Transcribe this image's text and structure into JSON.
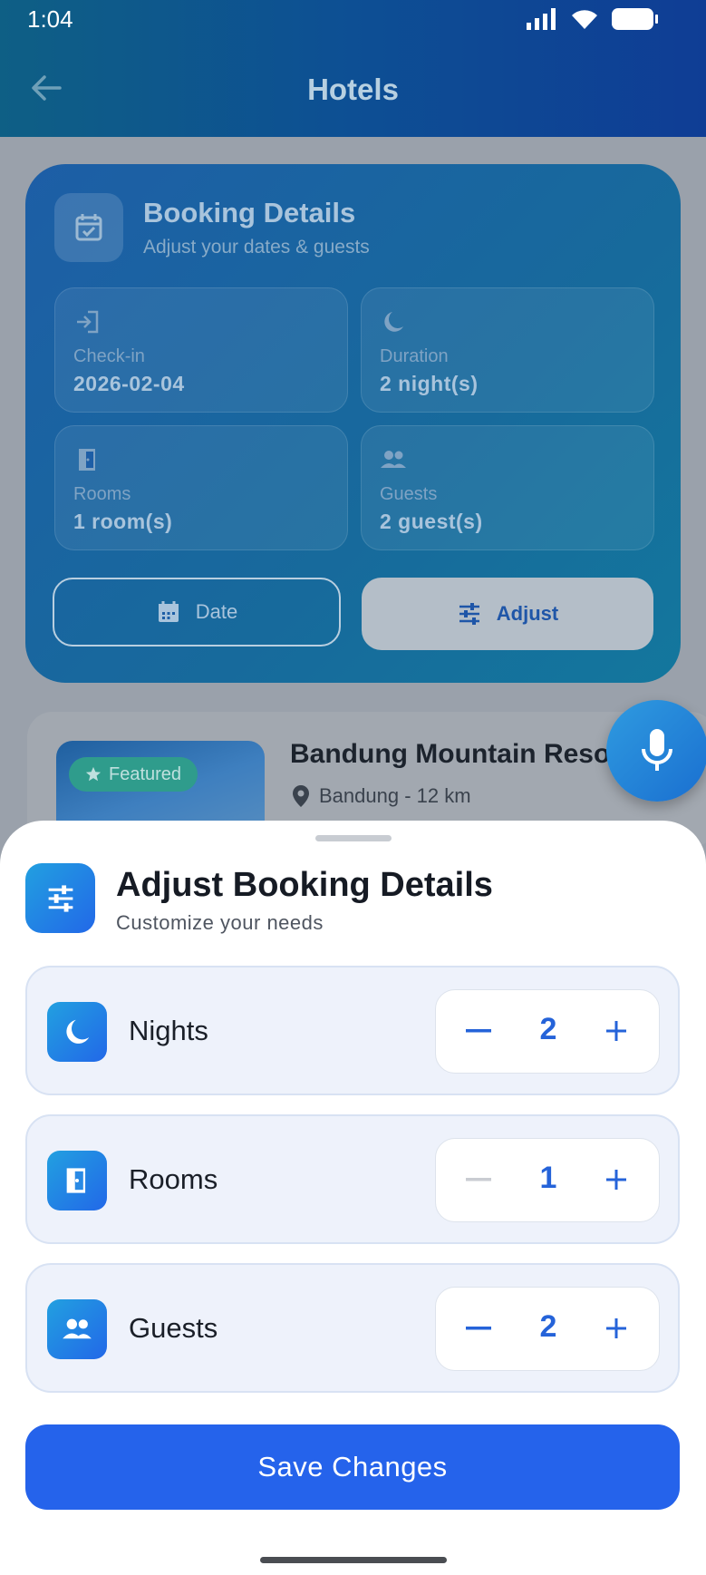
{
  "status": {
    "time": "1:04"
  },
  "appbar": {
    "title": "Hotels"
  },
  "booking": {
    "title": "Booking Details",
    "subtitle": "Adjust your dates & guests",
    "tiles": [
      {
        "label": "Check-in",
        "value": "2026-02-04",
        "icon": "login-icon"
      },
      {
        "label": "Duration",
        "value": "2 night(s)",
        "icon": "moon-icon"
      },
      {
        "label": "Rooms",
        "value": "1 room(s)",
        "icon": "door-icon"
      },
      {
        "label": "Guests",
        "value": "2 guest(s)",
        "icon": "people-icon"
      }
    ],
    "date_button": "Date",
    "adjust_button": "Adjust"
  },
  "hotel": {
    "badge": "Featured",
    "name": "Bandung Mountain Reso",
    "location": "Bandung - 12 km"
  },
  "sheet": {
    "title": "Adjust Booking Details",
    "subtitle": "Customize your needs",
    "rows": [
      {
        "label": "Nights",
        "value": "2",
        "minus_enabled": true
      },
      {
        "label": "Rooms",
        "value": "1",
        "minus_enabled": false
      },
      {
        "label": "Guests",
        "value": "2",
        "minus_enabled": true
      }
    ],
    "save_label": "Save Changes"
  },
  "colors": {
    "primary": "#2563eb",
    "accent": "#22a0e0",
    "disabled": "#b9bec6"
  }
}
